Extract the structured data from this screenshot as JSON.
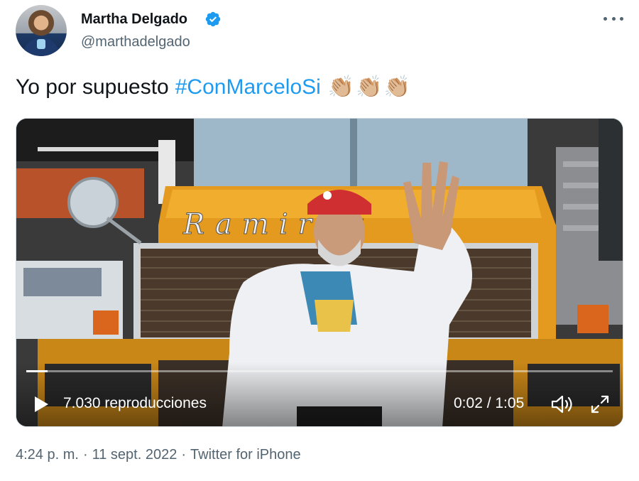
{
  "author": {
    "name": "Martha Delgado",
    "handle": "@marthadelgado",
    "verified": true
  },
  "tweet": {
    "text": "Yo por supuesto",
    "hashtag": "#ConMarceloSi",
    "emoji": [
      "👏🏼",
      "👏🏼",
      "👏🏼"
    ]
  },
  "video": {
    "truck_lettering": "Ramirez",
    "views": "7.030 reproducciones",
    "time": "0:02 / 1:05",
    "progress": 0.036
  },
  "meta": {
    "time": "4:24 p. m.",
    "date": "11 sept. 2022",
    "source": "Twitter for iPhone",
    "separator": "·"
  },
  "colors": {
    "link": "#1d9bf0",
    "secondary_text": "#536471",
    "verified": "#1d9bf0"
  },
  "icons": [
    "more-icon",
    "verified-badge-icon",
    "play-icon",
    "volume-icon",
    "fullscreen-icon"
  ]
}
